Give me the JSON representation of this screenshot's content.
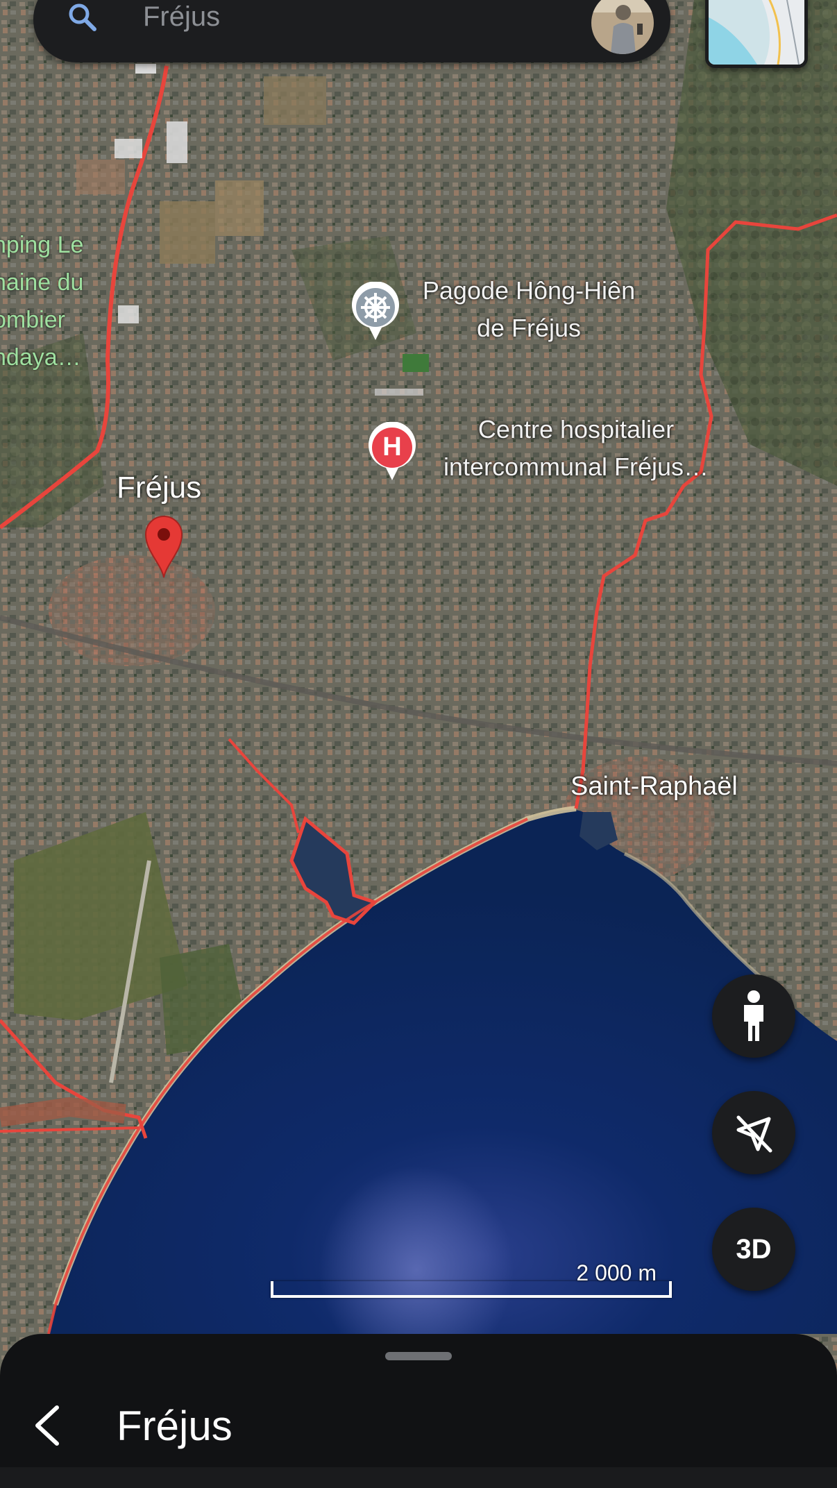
{
  "search": {
    "value": "Fréjus"
  },
  "map": {
    "labels": {
      "camping": [
        "nping Le",
        "naine du",
        "ombier",
        "ndaya…"
      ],
      "pagoda": [
        "Pagode Hông-Hiên",
        "de Fréjus"
      ],
      "hospital": [
        "Centre hospitalier",
        "intercommunal Fréjus…"
      ],
      "frejus": "Fréjus",
      "saint_raphael": "Saint-Raphaël"
    },
    "hospital_marker_letter": "H",
    "scale_text": "2 000 m",
    "colors": {
      "boundary": "#e8453c",
      "pin": "#e53935",
      "hospital": "#e8404b",
      "pagoda": "#9aa7b2",
      "sea": "#0d2a63"
    }
  },
  "controls": {
    "street_view_icon": "person-icon",
    "north_icon": "compass-off-icon",
    "three_d_label": "3D"
  },
  "sheet": {
    "title": "Fréjus",
    "back_icon": "chevron-left-icon"
  }
}
